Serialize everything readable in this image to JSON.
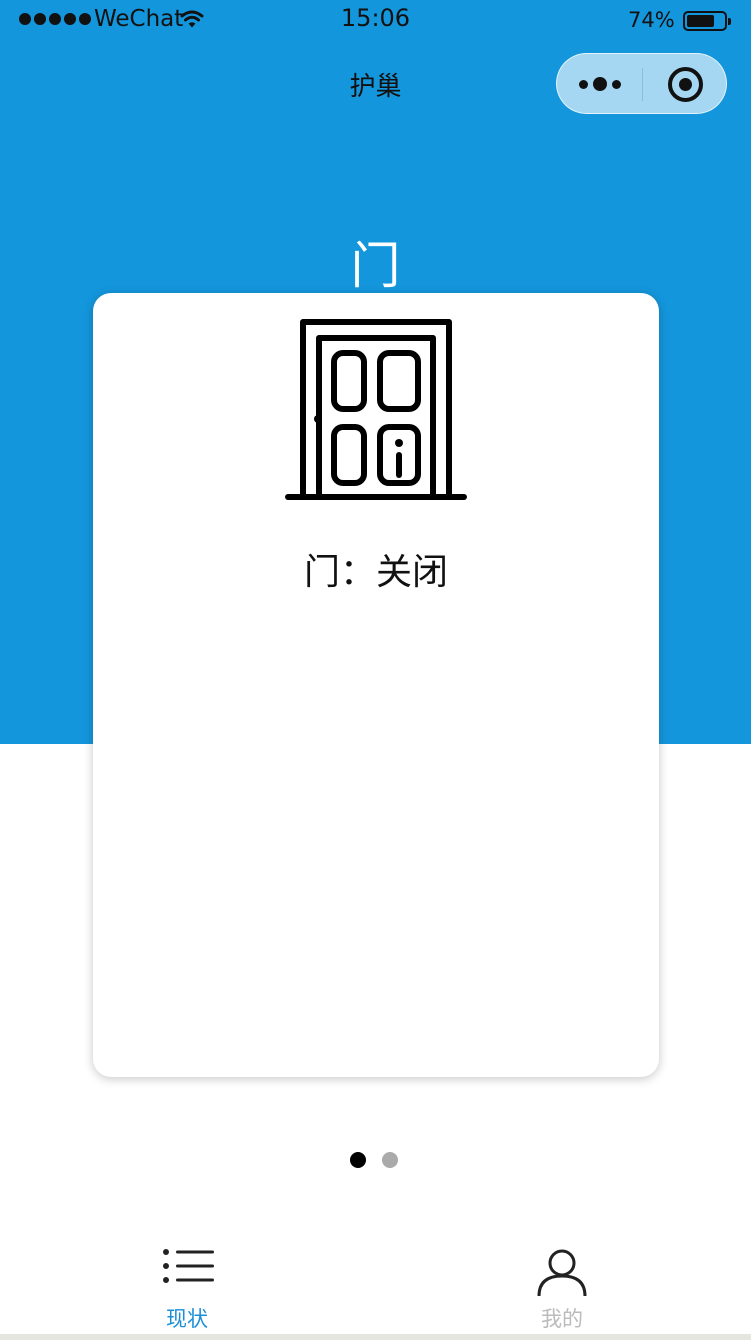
{
  "status_bar": {
    "carrier": "WeChat",
    "time": "15:06",
    "battery_percent_text": "74%",
    "battery_level": 0.74
  },
  "nav": {
    "title": "护巢",
    "menu_icon": "more-dots-icon",
    "close_icon": "target-circle-icon"
  },
  "section": {
    "title": "门"
  },
  "card": {
    "icon": "door-icon",
    "status_text": "门：关闭"
  },
  "pager": {
    "count": 2,
    "active_index": 0
  },
  "tabbar": {
    "tabs": [
      {
        "label": "现状",
        "icon": "list-icon",
        "active": true
      },
      {
        "label": "我的",
        "icon": "user-icon",
        "active": false
      }
    ]
  },
  "colors": {
    "header_blue": "#1496dc",
    "tab_active": "#1a8fd8",
    "tab_inactive": "#bbbbbb",
    "dot_active": "#000000",
    "dot_inactive": "#aaaaaa"
  }
}
